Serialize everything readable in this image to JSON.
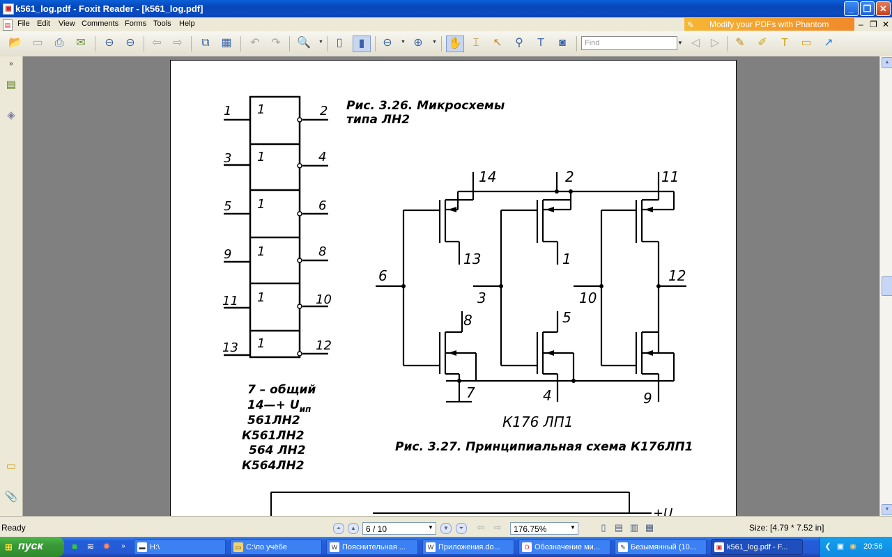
{
  "window": {
    "title": "k561_log.pdf - Foxit Reader - [k561_log.pdf]",
    "app_icon": "pdf-icon",
    "controls": [
      "minimize-icon",
      "restore-icon",
      "close-icon"
    ]
  },
  "menubar": {
    "items": [
      "File",
      "Edit",
      "View",
      "Comments",
      "Forms",
      "Tools",
      "Help"
    ],
    "promo": "Modify your PDFs with Phantom"
  },
  "toolbar": {
    "find_placeholder": "Find",
    "icons": [
      "open-icon",
      "save-icon",
      "print-icon",
      "email-icon",
      "prev-page-icon",
      "next-page-icon",
      "back-icon",
      "forward-icon",
      "extract-icon",
      "page-icon",
      "undo-icon",
      "redo-icon",
      "zoom-icon",
      "fit-page-icon",
      "fit-width-icon",
      "zoom-out-icon",
      "zoom-in-icon",
      "hand-icon",
      "select-text-icon",
      "select-icon",
      "find-icon",
      "typewriter-icon",
      "snapshot-icon",
      "find-prev-icon",
      "find-next-icon",
      "note-icon",
      "highlight-icon",
      "text-icon",
      "comment-icon",
      "arrow-icon"
    ]
  },
  "document": {
    "fig326_caption_line1": "Рис.   3.26.   Микросхемы",
    "fig326_caption_line2": "типа ЛН2",
    "left_pins": [
      "1",
      "3",
      "5",
      "9",
      "11",
      "13"
    ],
    "right_pins": [
      "2",
      "4",
      "6",
      "8",
      "10",
      "12"
    ],
    "gate_label": "1",
    "notes": [
      "7 – общий",
      "14—+ U",
      "561ЛН2",
      "К561ЛН2",
      "564 ЛН2",
      "К564ЛН2"
    ],
    "notes_subscript": "ип",
    "schem_top_pins": [
      "14",
      "2",
      "11"
    ],
    "schem_mid_pins": [
      "13",
      "1"
    ],
    "schem_inputs": [
      "6",
      "3",
      "10",
      "12"
    ],
    "schem_lower_pins": [
      "8",
      "5"
    ],
    "schem_bottom_pins": [
      "7",
      "4",
      "9"
    ],
    "schem_title": "К176 ЛП1",
    "fig327_caption": "Рис.  3.27.  Принципиальная  схема  К176ЛП1",
    "bottom_fragment": "+U"
  },
  "status": {
    "ready": "Ready",
    "page": "6 / 10",
    "zoom": "176.75%",
    "size": "Size: [4.79 * 7.52 in]"
  },
  "taskbar": {
    "start": "пуск",
    "tasks": [
      "H:\\",
      "C:\\по учёбе",
      "Пояснительная ...",
      "Приложения.do...",
      "Обозначение ми...",
      "Безымянный (10...",
      "k561_log.pdf - F..."
    ],
    "clock": "20:56"
  }
}
